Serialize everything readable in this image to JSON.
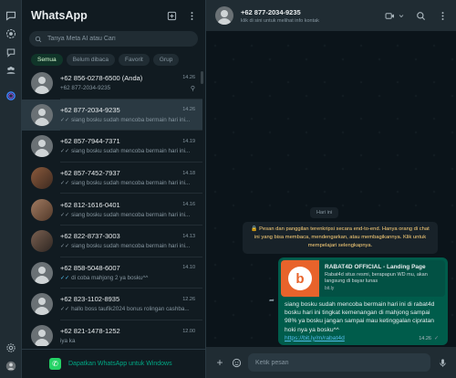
{
  "rail": {
    "icons": [
      "chats-icon",
      "status-icon",
      "channels-icon",
      "communities-icon",
      "meta-ai-icon",
      "settings-icon",
      "profile-icon"
    ]
  },
  "list": {
    "title": "WhatsApp",
    "search_placeholder": "Tanya Meta AI atau Cari",
    "filters": [
      "Semua",
      "Belum dibaca",
      "Favorit",
      "Grup"
    ],
    "chats": [
      {
        "name": "+62 856-0278-6500 (Anda)",
        "time": "14.26",
        "preview": "+62 877-2034-9235",
        "pinned": true,
        "tick": "none",
        "avatar": "default"
      },
      {
        "name": "+62 877-2034-9235",
        "time": "14.26",
        "preview": "siang  bosku sudah mencoba bermain hari ini...",
        "tick": "grey",
        "avatar": "default",
        "selected": true
      },
      {
        "name": "+62 857-7944-7371",
        "time": "14.19",
        "preview": "siang  bosku sudah mencoba bermain hari ini...",
        "tick": "grey",
        "avatar": "default"
      },
      {
        "name": "+62 857-7452-7937",
        "time": "14.18",
        "preview": "siang  bosku sudah mencoba bermain hari ini...",
        "tick": "grey",
        "avatar": "photo1"
      },
      {
        "name": "+62 812-1616-0401",
        "time": "14.16",
        "preview": "siang  bosku sudah mencoba bermain hari ini...",
        "tick": "grey",
        "avatar": "photo2"
      },
      {
        "name": "+62 822-8737-3003",
        "time": "14.13",
        "preview": "siang  bosku sudah mencoba bermain hari ini...",
        "tick": "grey",
        "avatar": "photo3"
      },
      {
        "name": "+62 858-5048-6007",
        "time": "14.10",
        "preview": "di coba mahjong 2 ya bosku^^",
        "tick": "blue",
        "avatar": "default"
      },
      {
        "name": "+62 823-1102-8935",
        "time": "12.26",
        "preview": "hallo boss taufik2024 bonus rolingan cashba...",
        "tick": "grey",
        "avatar": "default"
      },
      {
        "name": "+62 821-1478-1252",
        "time": "12.00",
        "preview": "iya ka",
        "tick": "none",
        "avatar": "default"
      }
    ],
    "get_app_text": "Dapatkan WhatsApp untuk Windows"
  },
  "conversation": {
    "name": "+62 877-2034-9235",
    "subtitle": "klik di sini untuk melihat info kontak",
    "day_label": "Hari ini",
    "e2e_notice": "Pesan dan panggilan terenkripsi secara end-to-end. Hanya orang di chat ini yang bisa membaca, mendengarkan, atau membagikannya. Klik untuk mempelajari selengkapnya.",
    "message": {
      "link_title": "RABAT4D OFFICIAL - Landing Page",
      "link_desc": "Rabat4d situs resmi, berapapun WD mu, akan langsung di bayar lunas",
      "link_domain": "bit.ly",
      "text": "siang  bosku sudah mencoba bermain hari ini di rabat4d bosku hari ini tingkat kemenangan di mahjong sampai 98% ya bosku jangan sampai mau ketinggalan cipratan hoki nya ya bosku^^",
      "link": "https://bit.ly/m/rabat4d",
      "time": "14.26"
    },
    "composer_placeholder": "Ketik pesan"
  },
  "colors": {
    "accent": "#00a884",
    "bubble_out": "#005c4b",
    "notice": "#ffd279"
  }
}
